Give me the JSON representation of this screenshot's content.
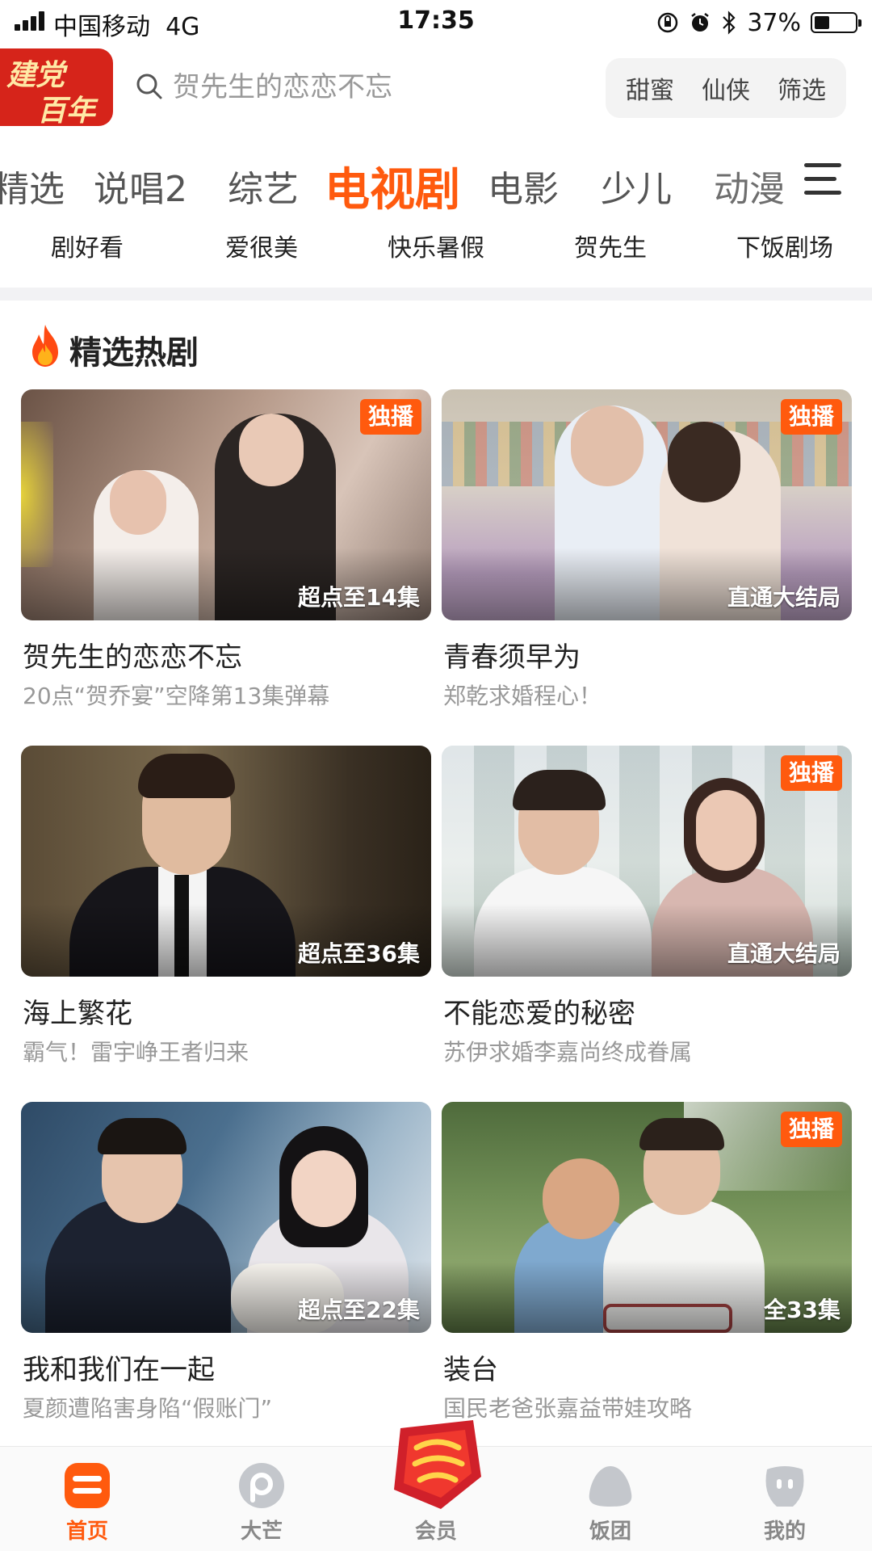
{
  "status_bar": {
    "carrier": "中国移动",
    "network": "4G",
    "time": "17:35",
    "battery_percent": "37%",
    "battery_level": 0.37
  },
  "header": {
    "logo_line1": "建党",
    "logo_line2": "百年",
    "search_placeholder": "贺先生的恋恋不忘",
    "quick_actions": [
      "甜蜜",
      "仙侠",
      "筛选"
    ]
  },
  "category_tabs": [
    {
      "label": "精选"
    },
    {
      "label": "说唱2"
    },
    {
      "label": "综艺"
    },
    {
      "label": "电视剧",
      "active": true
    },
    {
      "label": "电影"
    },
    {
      "label": "少儿"
    },
    {
      "label": "动漫"
    }
  ],
  "sub_tabs": [
    "剧好看",
    "爱很美",
    "快乐暑假",
    "贺先生",
    "下饭剧场"
  ],
  "section": {
    "title": "精选热剧"
  },
  "cards": [
    {
      "title": "贺先生的恋恋不忘",
      "subtitle": "20点“贺乔宴”空降第13集弹幕",
      "badge": "独播",
      "episode": "超点至14集"
    },
    {
      "title": "青春须早为",
      "subtitle": "郑乾求婚程心！",
      "badge": "独播",
      "episode": "直通大结局"
    },
    {
      "title": "海上繁花",
      "subtitle": "霸气！雷宇峥王者归来",
      "badge": "",
      "episode": "超点至36集"
    },
    {
      "title": "不能恋爱的秘密",
      "subtitle": "苏伊求婚李嘉尚终成眷属",
      "badge": "独播",
      "episode": "直通大结局"
    },
    {
      "title": "我和我们在一起",
      "subtitle": "夏颜遭陷害身陷“假账门”",
      "badge": "",
      "episode": "超点至22集"
    },
    {
      "title": "装台",
      "subtitle": "国民老爸张嘉益带娃攻略",
      "badge": "独播",
      "episode": "全33集"
    }
  ],
  "bottom_nav": [
    {
      "label": "首页",
      "icon": "home-icon",
      "active": true
    },
    {
      "label": "大芒",
      "icon": "mango-icon"
    },
    {
      "label": "会员",
      "icon": "vip-icon"
    },
    {
      "label": "饭团",
      "icon": "fan-group-icon"
    },
    {
      "label": "我的",
      "icon": "profile-icon"
    }
  ],
  "colors": {
    "accent": "#ff5a0e",
    "logo_red": "#d6241a",
    "text_primary": "#222222",
    "text_secondary": "#999999"
  }
}
